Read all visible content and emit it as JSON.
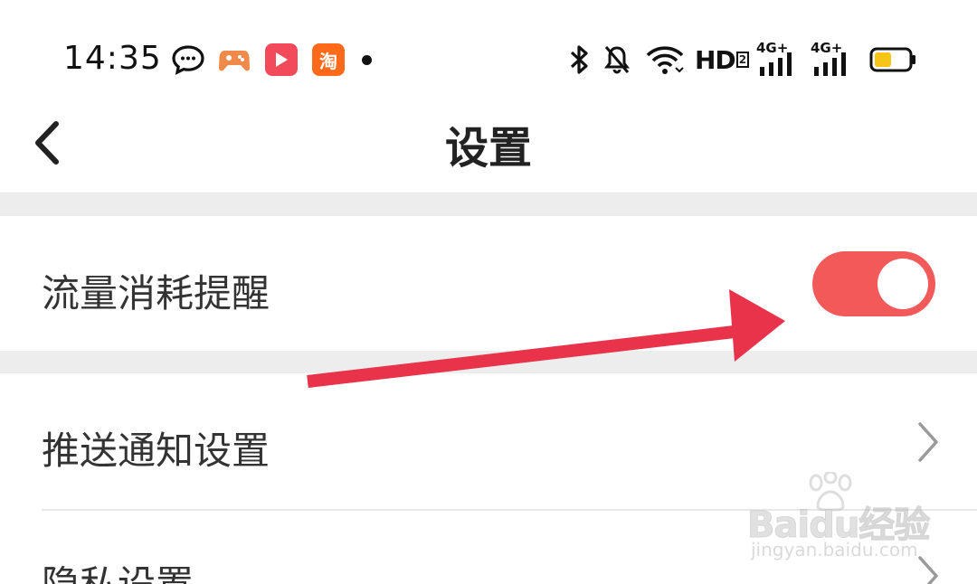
{
  "status_bar": {
    "time": "14:35",
    "app_icons": [
      "chat-bubble-icon",
      "game-controller-icon",
      "video-play-icon",
      "taobao-icon"
    ],
    "taobao_label": "淘",
    "hd_label": "HD",
    "hd_sub": "2",
    "network_1": "4G+",
    "network_2": "4G+",
    "battery_color": "#f5c518"
  },
  "header": {
    "title": "设置",
    "back_icon": "chevron-left-icon"
  },
  "settings": {
    "traffic_reminder": {
      "label": "流量消耗提醒",
      "enabled": true
    },
    "push_notification": {
      "label": "推送通知设置"
    },
    "privacy": {
      "label": "隐私设置"
    }
  },
  "colors": {
    "accent": "#f25a5a",
    "annotation_arrow": "#e8334a",
    "separator": "#ededed"
  },
  "watermark": {
    "brand": "Baidu经验",
    "url": "jingyan.baidu.com"
  }
}
